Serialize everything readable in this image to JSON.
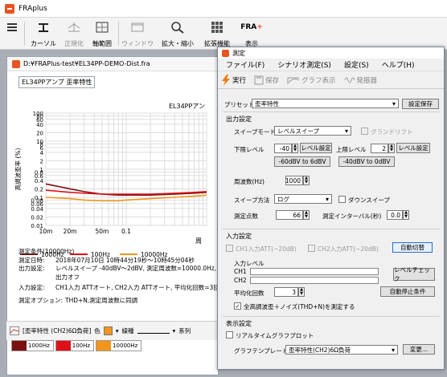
{
  "app": {
    "title": "FRAplus"
  },
  "toolbar": {
    "cursor": "カーソル",
    "normalize": "正規化",
    "axis": "軸範囲",
    "window": "ウィンドウ",
    "zoom": "拡大・縮小",
    "ext": "拡張機能",
    "display": "表示"
  },
  "doc": {
    "path": "D:¥FRAPlus-test¥EL34PP-DEMO-Dist.fra",
    "caption": "EL34PPアンプ 歪率特性"
  },
  "chart_data": {
    "type": "line",
    "title": "EL34PPアン",
    "ylabel": "高調波歪率 (%)",
    "xlabel": "周",
    "yscale": "log",
    "xscale": "log",
    "ylim": [
      0.01,
      100
    ],
    "xlim": [
      10,
      1000
    ],
    "y_ticks": [
      "100",
      "80",
      "60",
      "40",
      "20",
      "10",
      "8",
      "6",
      "4",
      "2",
      "1",
      "0.8",
      "0.6",
      "0.4",
      "0.2",
      "0.1",
      "0.08",
      "0.06",
      "0.04",
      "0.02",
      "0.01"
    ],
    "x_ticks": [
      "10m",
      "20m",
      "50m",
      "0.1"
    ],
    "series": [
      {
        "name": "1000Hz",
        "color": "#7a1010",
        "x": [
          10,
          20,
          30,
          50,
          80,
          100,
          200,
          400,
          700,
          1000
        ],
        "y": [
          0.3,
          0.2,
          0.16,
          0.13,
          0.12,
          0.12,
          0.12,
          0.13,
          0.14,
          0.15
        ]
      },
      {
        "name": "100Hz",
        "color": "#e0101a",
        "x": [
          10,
          20,
          30,
          50,
          80,
          100,
          200,
          400,
          700,
          1000
        ],
        "y": [
          0.18,
          0.15,
          0.14,
          0.13,
          0.13,
          0.13,
          0.13,
          0.14,
          0.15,
          0.16
        ]
      },
      {
        "name": "10000Hz",
        "color": "#f2951a",
        "x": [
          10,
          20,
          30,
          50,
          80,
          100,
          200,
          400,
          700,
          1000
        ],
        "y": [
          0.1,
          0.09,
          0.08,
          0.075,
          0.075,
          0.08,
          0.09,
          0.1,
          0.11,
          0.12
        ]
      }
    ]
  },
  "conditions": {
    "header": "測定条件(10000Hz)",
    "date_label": "測定日時:",
    "date_value": "2018年07月10日 10時44分19秒〜10時45分04秒",
    "out_label": "出力設定:",
    "out_value": "レベルスイープ -40dBV〜2dBV, 測定周波数=10000.0Hz, 66(",
    "out_value2": "出力オフ",
    "in_label": "入力設定:",
    "in_value": "CH1入力 ATTオート, CH2入力 ATTオート, 平均化回数=3回",
    "opt_label": "測定オプション:",
    "opt_value": "THD+N,測定周波数に同調"
  },
  "bottom_bar": {
    "series": "[歪率特性 (CH2)6Ω負荷]",
    "color_label": "色",
    "line_label": "線種",
    "extra": "系列"
  },
  "legend_tabs": [
    {
      "label": "1000Hz",
      "color": "#7a1010"
    },
    {
      "label": "100Hz",
      "color": "#e0101a"
    },
    {
      "label": "10000Hz",
      "color": "#f2951a"
    }
  ],
  "dialog": {
    "title": "測定",
    "menu": [
      "ファイル(F)",
      "シナリオ測定(S)",
      "設定(S)",
      "ヘルプ(H)"
    ],
    "tools": {
      "run": "実行",
      "save": "保存",
      "graph": "グラフ表示",
      "gen": "発振器"
    },
    "preset_label": "プリセット",
    "preset_value": "歪率特性",
    "preset_save": "設定保存",
    "output_section": "出力設定",
    "sweep_mode_label": "スイープモード",
    "sweep_mode_value": "レベルスイープ",
    "grand_drift": "グランドリフト",
    "low_level_label": "下限レベル",
    "low_level_value": "-40",
    "level_set": "レベル設定",
    "high_level_label": "上限レベル",
    "high_level_value": "2",
    "btn_low": "-60dBV to 6dBV",
    "btn_high": "-40dBV to 0dBV",
    "freq_label": "周波数(Hz)",
    "freq_value": "1000",
    "sweep_method_label": "スイープ方法",
    "sweep_method_value": "ログ",
    "down_sweep": "ダウンスイープ",
    "points_label": "測定点数",
    "points_value": "66",
    "interval_label": "測定インターバル(秒)",
    "interval_value": "0.0",
    "input_section": "入力設定",
    "ch1_att": "CH1入力ATT(−20dB)",
    "ch2_att": "CH2入力ATT(−20dB)",
    "auto_switch": "自動切替",
    "input_level": "入力レベル",
    "ch1": "CH1",
    "ch2": "CH2",
    "level_check": "レベルチェック",
    "avg_label": "平均化回数",
    "avg_value": "3",
    "auto_stop": "自動停止条件",
    "thd_check": "全高調波歪＋ノイズ(THD+N)を測定する",
    "display_section": "表示設定",
    "realtime": "リアルタイムグラフプロット",
    "template_label": "グラフテンプレート",
    "template_value": "歪率特性(CH2)6Ω負荷",
    "change": "変更..."
  }
}
